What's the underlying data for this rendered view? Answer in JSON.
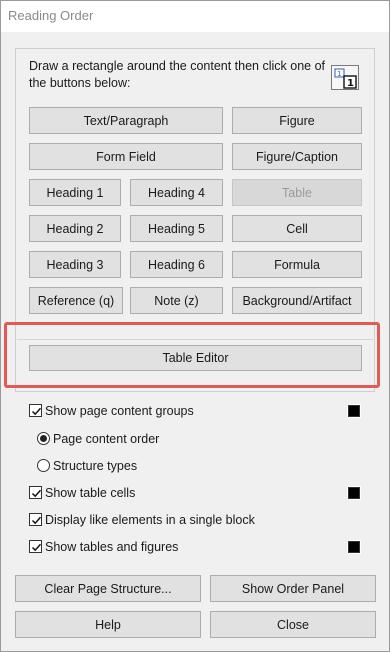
{
  "window": {
    "title": "Reading Order"
  },
  "instructions": "Draw a rectangle around the content then click one of the buttons below:",
  "tag_buttons": {
    "text_paragraph": "Text/Paragraph",
    "figure": "Figure",
    "form_field": "Form Field",
    "figure_caption": "Figure/Caption",
    "heading1": "Heading 1",
    "heading4": "Heading 4",
    "table": "Table",
    "heading2": "Heading 2",
    "heading5": "Heading 5",
    "cell": "Cell",
    "heading3": "Heading 3",
    "heading6": "Heading 6",
    "formula": "Formula",
    "reference": "Reference (q)",
    "note": "Note (z)",
    "background_artifact": "Background/Artifact"
  },
  "table_editor": "Table Editor",
  "options": {
    "show_page_content_groups": {
      "label": "Show page content groups",
      "checked": true,
      "swatch": "#000000"
    },
    "page_content_order": {
      "label": "Page content order",
      "selected": true
    },
    "structure_types": {
      "label": "Structure types",
      "selected": false
    },
    "show_table_cells": {
      "label": "Show table cells",
      "checked": true,
      "swatch": "#000000"
    },
    "display_like_elements": {
      "label": "Display like elements in a single block",
      "checked": true
    },
    "show_tables_and_figures": {
      "label": "Show tables and figures",
      "checked": true,
      "swatch": "#000000"
    }
  },
  "footer": {
    "clear_page_structure": "Clear Page Structure...",
    "show_order_panel": "Show Order Panel",
    "help": "Help",
    "close": "Close"
  },
  "colors": {
    "highlight": "#e15b55",
    "button_bg": "#e1e1e1",
    "dialog_bg": "#f0f0f0"
  }
}
